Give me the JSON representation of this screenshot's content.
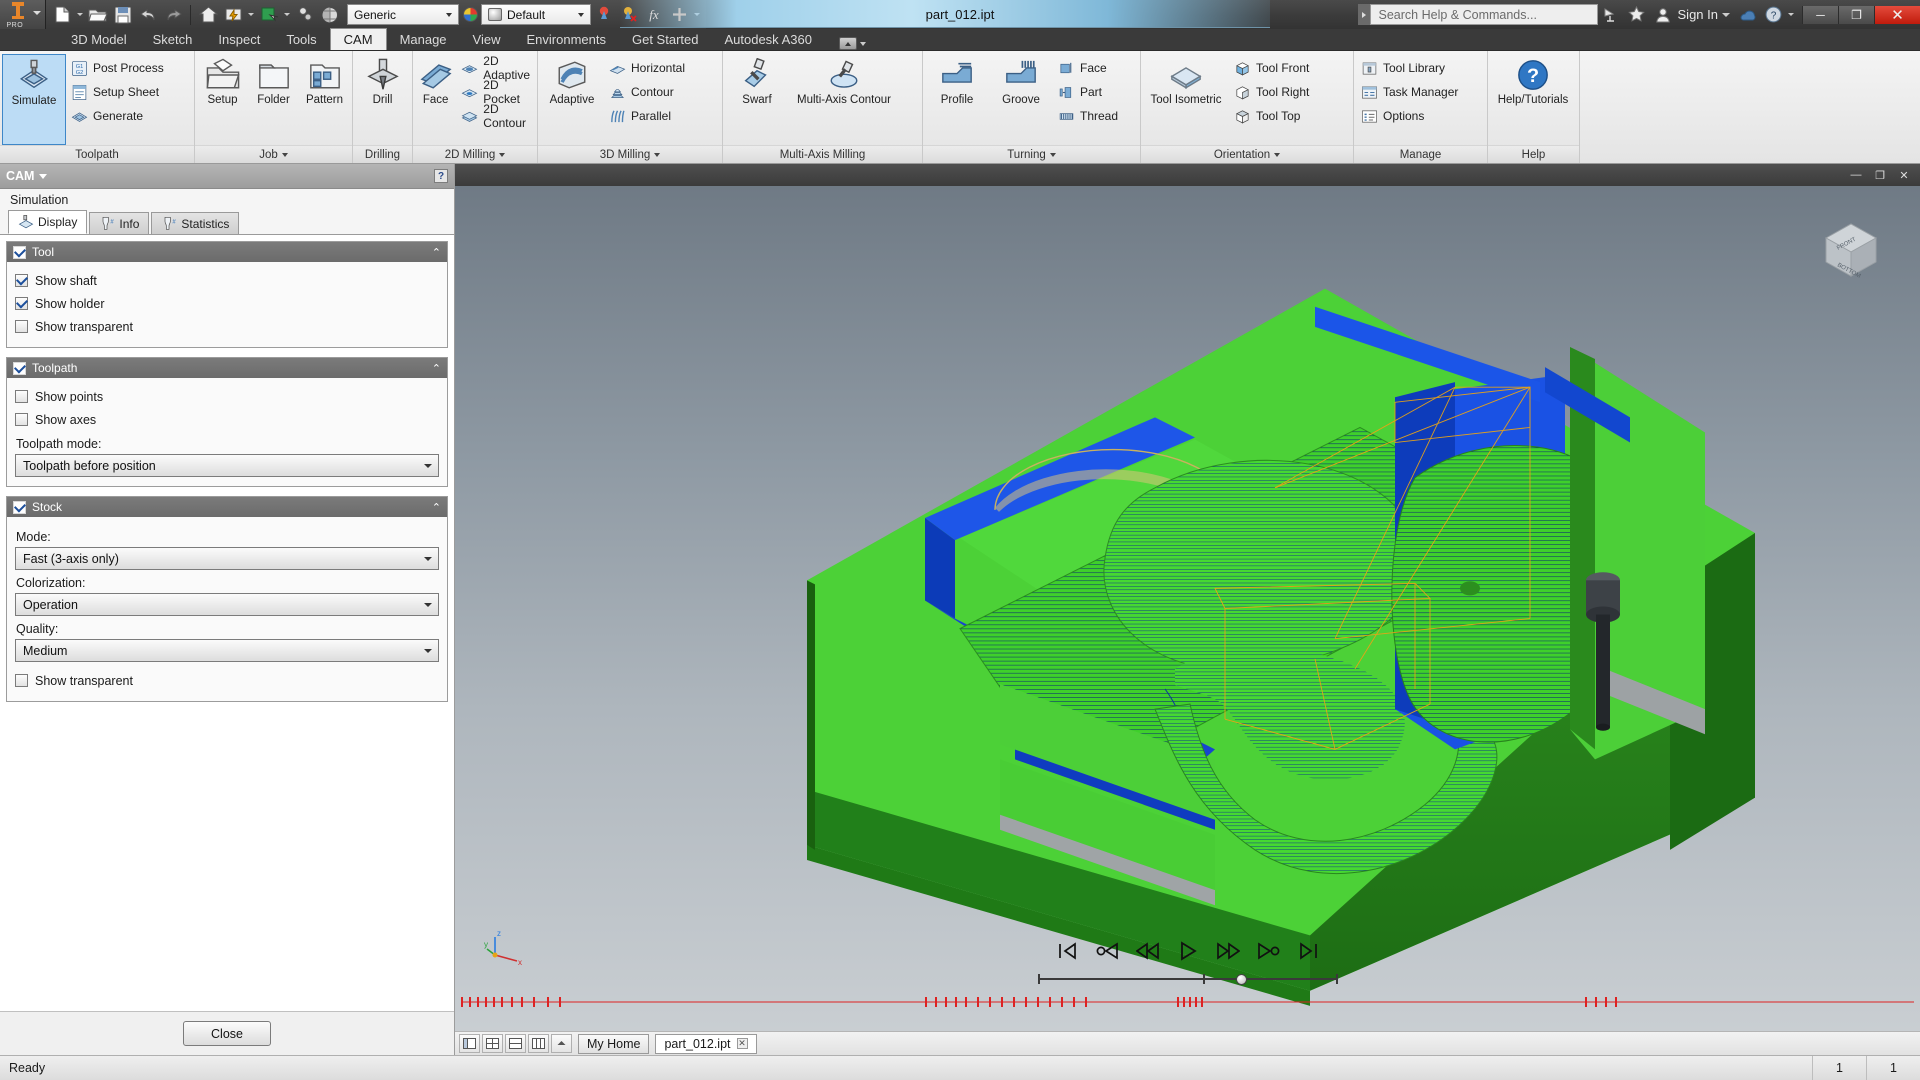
{
  "app": {
    "title": "part_012.ipt",
    "logo_text": "PRO"
  },
  "quick_access": {
    "items": [
      {
        "name": "new-file-icon",
        "label": "New"
      },
      {
        "name": "open-file-icon",
        "label": "Open"
      },
      {
        "name": "save-icon",
        "label": "Save"
      },
      {
        "name": "undo-icon",
        "label": "Undo"
      },
      {
        "name": "redo-icon",
        "label": "Redo"
      },
      {
        "name": "home-icon",
        "label": "Home"
      },
      {
        "name": "update-icon",
        "label": "Update"
      },
      {
        "name": "return-icon",
        "label": "Return"
      },
      {
        "name": "select-icon",
        "label": "Select"
      },
      {
        "name": "appearance-icon",
        "label": "Appearance"
      }
    ],
    "material_value": "Generic",
    "appearance_value": "Default"
  },
  "search": {
    "placeholder": "Search Help & Commands..."
  },
  "account": {
    "sign_in": "Sign In",
    "exchange_icon": "exchange-app-icon",
    "favorites_icon": "star-icon",
    "help_icon": "help-icon"
  },
  "window_controls": {
    "minimize": "─",
    "restore": "❐",
    "close": "✕"
  },
  "ribbon": {
    "tabs": [
      {
        "label": "3D Model",
        "active": false
      },
      {
        "label": "Sketch",
        "active": false
      },
      {
        "label": "Inspect",
        "active": false
      },
      {
        "label": "Tools",
        "active": false
      },
      {
        "label": "CAM",
        "active": true
      },
      {
        "label": "Manage",
        "active": false
      },
      {
        "label": "View",
        "active": false
      },
      {
        "label": "Environments",
        "active": false
      },
      {
        "label": "Get Started",
        "active": false
      },
      {
        "label": "Autodesk A360",
        "active": false
      }
    ],
    "panels": [
      {
        "name": "toolpath",
        "label": "Toolpath",
        "has_dropdown": false,
        "big": [
          {
            "label": "Simulate",
            "icon": "simulate-icon",
            "selected": true
          }
        ],
        "small": [
          {
            "label": "Post Process",
            "icon": "post-process-icon"
          },
          {
            "label": "Setup Sheet",
            "icon": "setup-sheet-icon"
          },
          {
            "label": "Generate",
            "icon": "generate-icon"
          }
        ]
      },
      {
        "name": "job",
        "label": "Job",
        "has_dropdown": true,
        "big": [
          {
            "label": "Setup",
            "icon": "setup-icon",
            "selected": false
          },
          {
            "label": "Folder",
            "icon": "folder-icon",
            "selected": false
          },
          {
            "label": "Pattern",
            "icon": "pattern-icon",
            "selected": false
          }
        ],
        "small": []
      },
      {
        "name": "drilling",
        "label": "Drilling",
        "has_dropdown": false,
        "big": [
          {
            "label": "Drill",
            "icon": "drill-icon",
            "selected": false
          }
        ],
        "small": []
      },
      {
        "name": "2d-milling",
        "label": "2D Milling",
        "has_dropdown": true,
        "big": [
          {
            "label": "Face",
            "icon": "face-mill-icon",
            "selected": false
          }
        ],
        "small": [
          {
            "label": "2D Adaptive",
            "icon": "2d-adaptive-icon"
          },
          {
            "label": "2D Pocket",
            "icon": "2d-pocket-icon"
          },
          {
            "label": "2D Contour",
            "icon": "2d-contour-icon"
          }
        ]
      },
      {
        "name": "3d-milling",
        "label": "3D Milling",
        "has_dropdown": true,
        "big": [
          {
            "label": "Adaptive",
            "icon": "adaptive-icon",
            "selected": false
          }
        ],
        "small": [
          {
            "label": "Horizontal",
            "icon": "horizontal-icon"
          },
          {
            "label": "Contour",
            "icon": "contour-icon"
          },
          {
            "label": "Parallel",
            "icon": "parallel-icon"
          }
        ]
      },
      {
        "name": "multi-axis-milling",
        "label": "Multi-Axis Milling",
        "has_dropdown": false,
        "big": [
          {
            "label": "Swarf",
            "icon": "swarf-icon",
            "selected": false
          },
          {
            "label": "Multi-Axis Contour",
            "icon": "multi-axis-contour-icon",
            "selected": false
          }
        ],
        "small": []
      },
      {
        "name": "turning",
        "label": "Turning",
        "has_dropdown": true,
        "big": [
          {
            "label": "Profile",
            "icon": "profile-icon",
            "selected": false
          },
          {
            "label": "Groove",
            "icon": "groove-icon",
            "selected": false
          }
        ],
        "small": [
          {
            "label": "Face",
            "icon": "turn-face-icon"
          },
          {
            "label": "Part",
            "icon": "turn-part-icon"
          },
          {
            "label": "Thread",
            "icon": "turn-thread-icon"
          }
        ]
      },
      {
        "name": "orientation",
        "label": "Orientation",
        "has_dropdown": true,
        "big": [
          {
            "label": "Tool Isometric",
            "icon": "tool-isometric-icon",
            "selected": false
          }
        ],
        "small": [
          {
            "label": "Tool Front",
            "icon": "tool-front-icon"
          },
          {
            "label": "Tool Right",
            "icon": "tool-right-icon"
          },
          {
            "label": "Tool Top",
            "icon": "tool-top-icon"
          }
        ]
      },
      {
        "name": "manage",
        "label": "Manage",
        "has_dropdown": false,
        "big": [],
        "small": [
          {
            "label": "Tool Library",
            "icon": "tool-library-icon"
          },
          {
            "label": "Task Manager",
            "icon": "task-manager-icon"
          },
          {
            "label": "Options",
            "icon": "options-icon"
          }
        ]
      },
      {
        "name": "help",
        "label": "Help",
        "has_dropdown": false,
        "big": [
          {
            "label": "Help/Tutorials",
            "icon": "help-tutorials-icon",
            "selected": false
          }
        ],
        "small": []
      }
    ]
  },
  "cam_panel": {
    "title": "CAM",
    "subtitle": "Simulation",
    "tabs": [
      {
        "label": "Display",
        "icon": "display-tab-icon",
        "active": true
      },
      {
        "label": "Info",
        "icon": "info-tab-icon",
        "active": false
      },
      {
        "label": "Statistics",
        "icon": "statistics-tab-icon",
        "active": false
      }
    ],
    "groups": [
      {
        "name": "tool",
        "title": "Tool",
        "enabled": true,
        "checkboxes": [
          {
            "label": "Show shaft",
            "checked": true
          },
          {
            "label": "Show holder",
            "checked": true
          },
          {
            "label": "Show transparent",
            "checked": false
          }
        ],
        "fields": []
      },
      {
        "name": "toolpath",
        "title": "Toolpath",
        "enabled": true,
        "checkboxes": [
          {
            "label": "Show points",
            "checked": false
          },
          {
            "label": "Show axes",
            "checked": false
          }
        ],
        "fields": [
          {
            "label": "Toolpath mode:",
            "value": "Toolpath before position"
          }
        ]
      },
      {
        "name": "stock",
        "title": "Stock",
        "enabled": true,
        "checkboxes": [],
        "fields": [
          {
            "label": "Mode:",
            "value": "Fast (3-axis only)"
          },
          {
            "label": "Colorization:",
            "value": "Operation"
          },
          {
            "label": "Quality:",
            "value": "Medium"
          }
        ],
        "checkboxes_after": [
          {
            "label": "Show transparent",
            "checked": false
          }
        ]
      }
    ],
    "close_button": "Close",
    "help_glyph": "?"
  },
  "viewport": {
    "viewcube_faces": [
      "FRONT",
      "BOTTOM"
    ],
    "axis_labels": [
      "X",
      "Y",
      "Z"
    ],
    "playback": [
      {
        "name": "skip-to-start-button",
        "glyph": "first"
      },
      {
        "name": "step-back-section-button",
        "glyph": "prev-section"
      },
      {
        "name": "rewind-button",
        "glyph": "rewind"
      },
      {
        "name": "play-button",
        "glyph": "play"
      },
      {
        "name": "fast-forward-button",
        "glyph": "forward"
      },
      {
        "name": "step-forward-section-button",
        "glyph": "next-section"
      },
      {
        "name": "skip-to-end-button",
        "glyph": "last"
      }
    ],
    "slider_position_pct": 66
  },
  "document_tabs": {
    "view_buttons": [
      {
        "name": "view-tiles-button"
      },
      {
        "name": "view-grid-button"
      },
      {
        "name": "view-split-horizontal-button"
      },
      {
        "name": "view-split-vertical-button"
      },
      {
        "name": "view-more-button"
      }
    ],
    "tabs": [
      {
        "label": "My Home",
        "active": false,
        "closable": false
      },
      {
        "label": "part_012.ipt",
        "active": true,
        "closable": true
      }
    ]
  },
  "status_bar": {
    "message": "Ready",
    "cell_left": "1",
    "cell_right": "1"
  },
  "colors": {
    "accent_blue": "#3e87c8",
    "selected_fill": "#bcdcf5",
    "stock_green": "#4cd137",
    "toolpath_blue": "#1044d8",
    "title_highlight": "#9fd0ea",
    "close_red": "#c01b0c",
    "logo_orange": "#e8862a",
    "group_header": "#6b6b6b"
  }
}
